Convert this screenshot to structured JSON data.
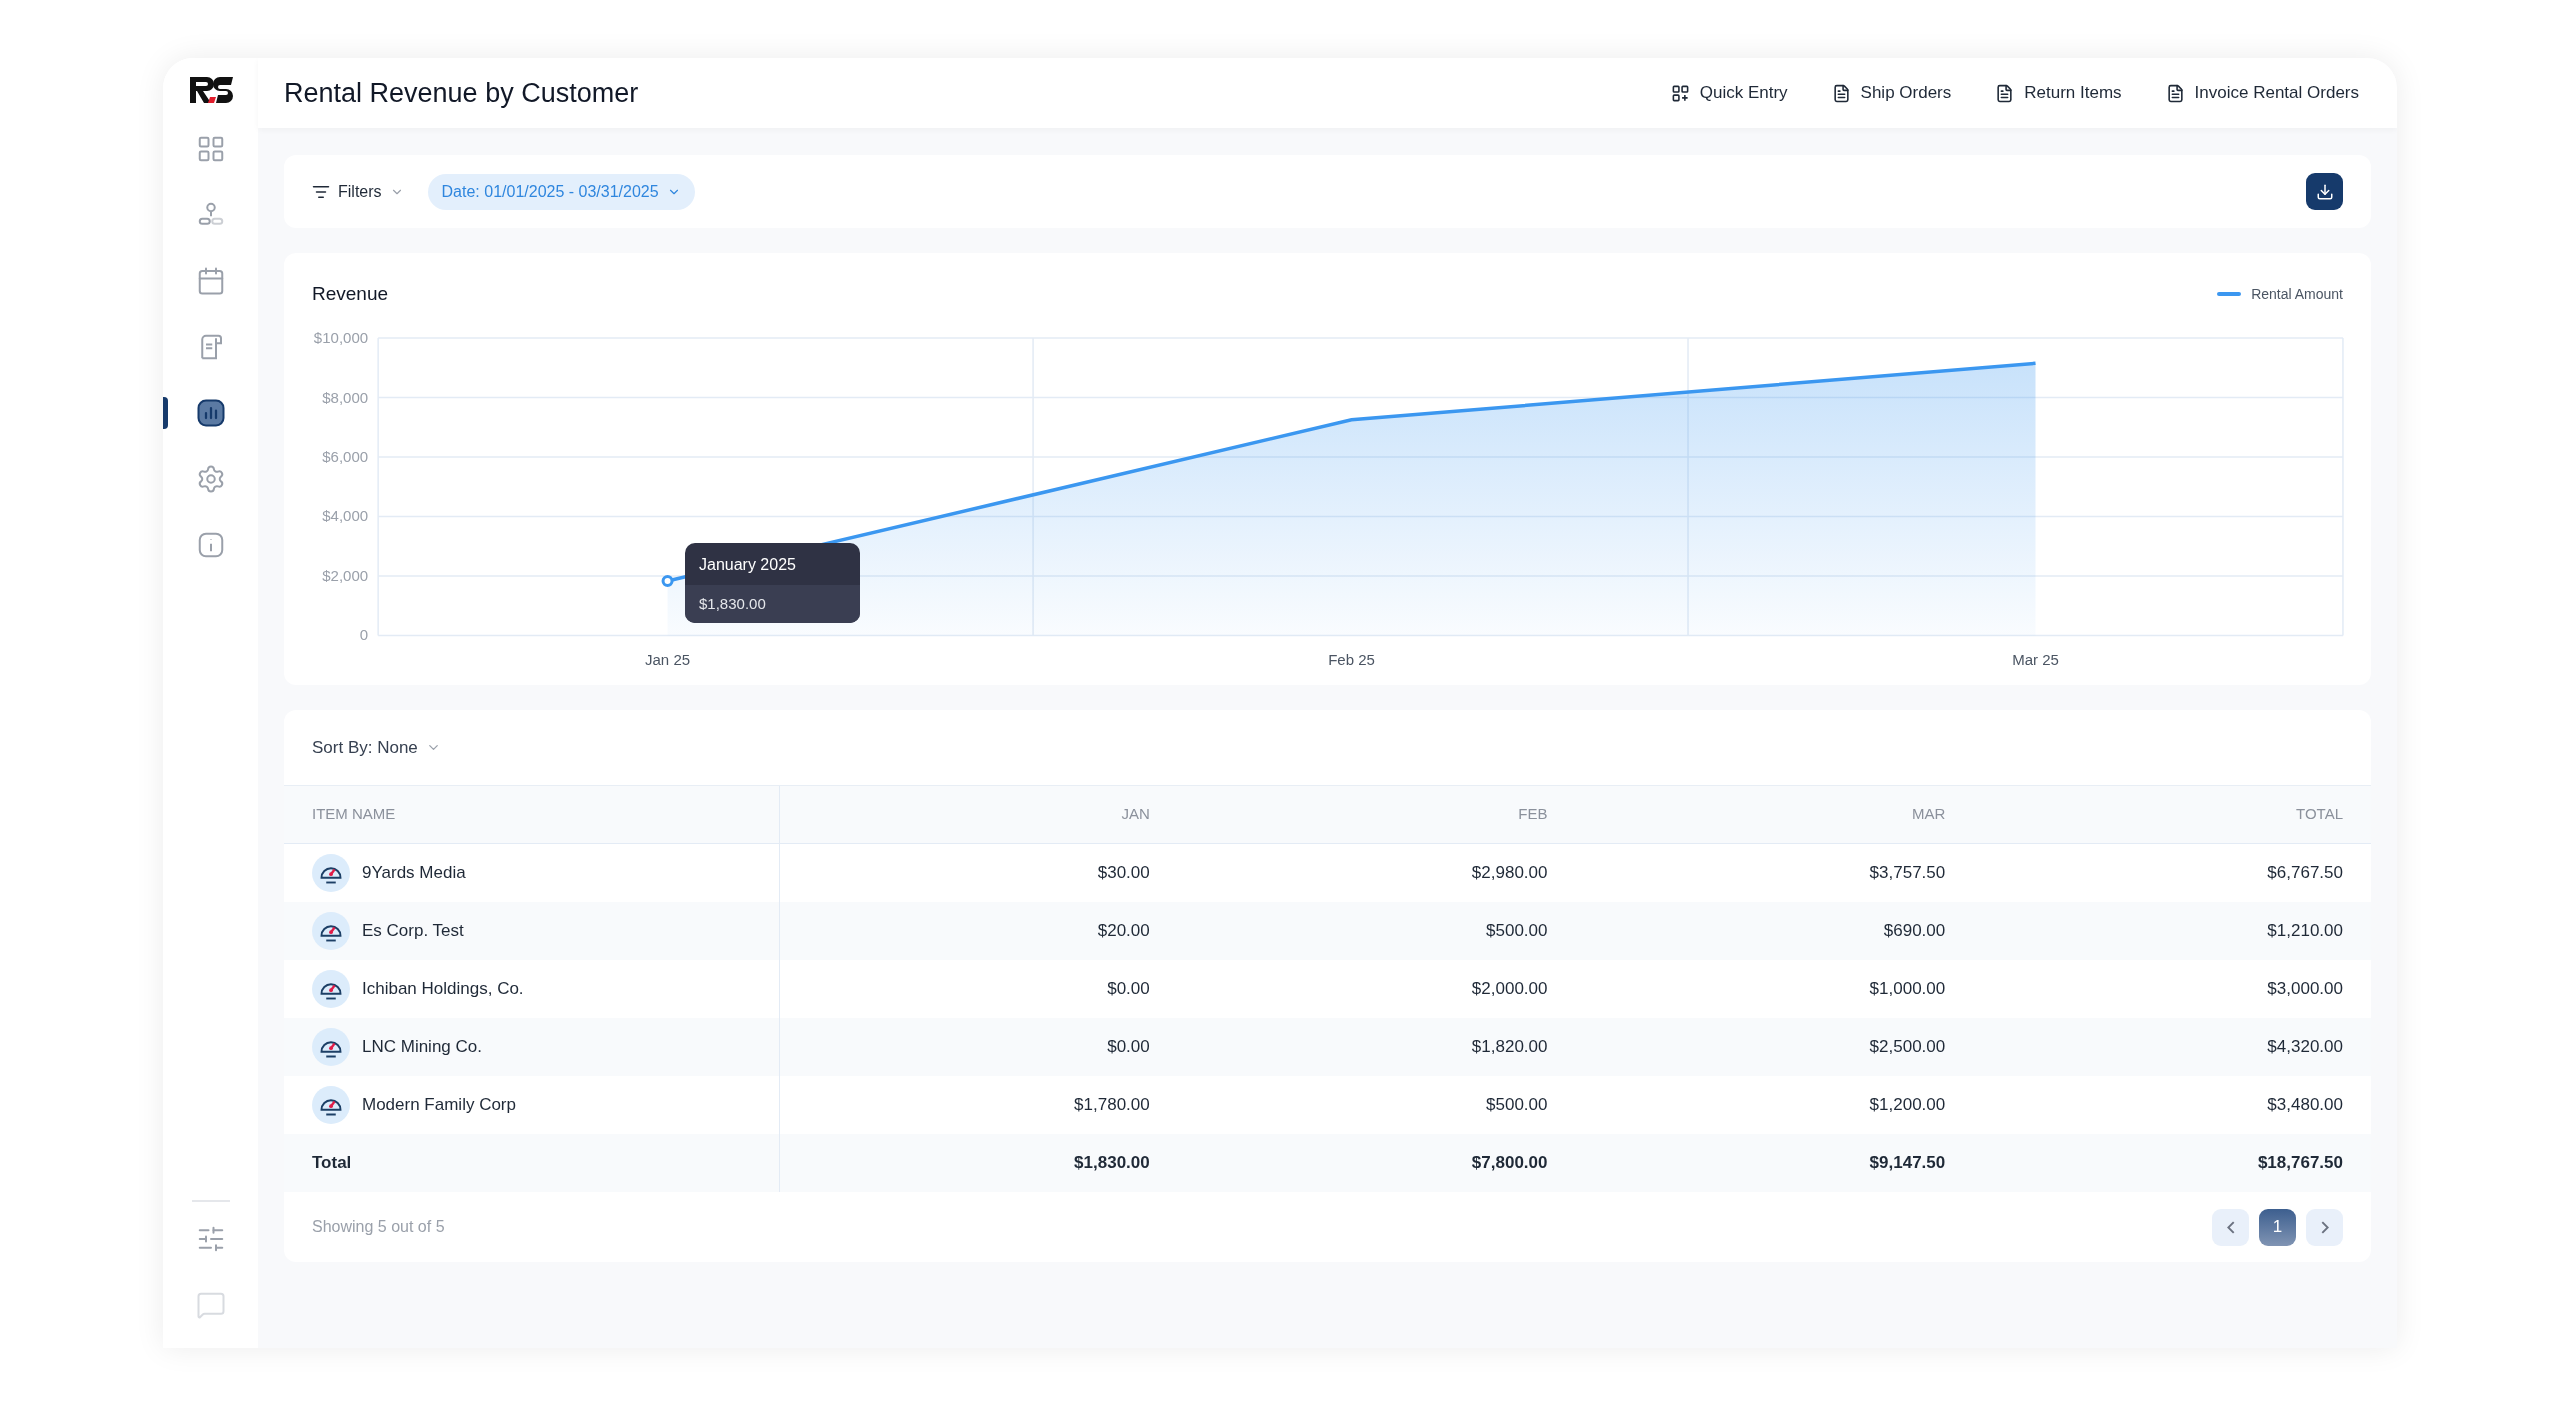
{
  "sidebar": {
    "items": [
      {
        "selected": false
      },
      {
        "selected": false
      },
      {
        "selected": false
      },
      {
        "selected": false
      },
      {
        "selected": true
      },
      {
        "selected": false
      },
      {
        "selected": false
      }
    ],
    "bottom_items": [
      {
        "selected": false
      },
      {
        "selected": false
      }
    ]
  },
  "header": {
    "title": "Rental Revenue by Customer",
    "actions": [
      {
        "label": "Quick Entry"
      },
      {
        "label": "Ship Orders"
      },
      {
        "label": "Return Items"
      },
      {
        "label": "Invoice Rental Orders"
      }
    ]
  },
  "filters": {
    "label": "Filters",
    "date_filter": "Date: 01/01/2025 - 03/31/2025"
  },
  "chart": {
    "title": "Revenue",
    "tooltip": {
      "title": "January 2025",
      "value": "$1,830.00"
    },
    "chart_data": {
      "type": "area",
      "categories": [
        "Jan 25",
        "Feb 25",
        "Mar 25"
      ],
      "series": [
        {
          "name": "Rental Amount",
          "color": "#3b97f0",
          "values": [
            1830,
            7250,
            9150
          ]
        }
      ],
      "ylim": [
        0,
        10000
      ],
      "grid": true,
      "yticks": [
        {
          "value": 0,
          "label": "0"
        },
        {
          "value": 2000,
          "label": "$2,000"
        },
        {
          "value": 4000,
          "label": "$4,000"
        },
        {
          "value": 6000,
          "label": "$6,000"
        },
        {
          "value": 8000,
          "label": "$8,000"
        },
        {
          "value": 10000,
          "label": "$10,000"
        }
      ]
    }
  },
  "table": {
    "sort_label": "Sort By: None",
    "columns": [
      "ITEM NAME",
      "JAN",
      "FEB",
      "MAR",
      "TOTAL"
    ],
    "rows": [
      {
        "cells": [
          "9Yards Media",
          "$30.00",
          "$2,980.00",
          "$3,757.50",
          "$6,767.50"
        ]
      },
      {
        "cells": [
          "Es Corp. Test",
          "$20.00",
          "$500.00",
          "$690.00",
          "$1,210.00"
        ]
      },
      {
        "cells": [
          "Ichiban Holdings, Co.",
          "$0.00",
          "$2,000.00",
          "$1,000.00",
          "$3,000.00"
        ]
      },
      {
        "cells": [
          "LNC Mining Co.",
          "$0.00",
          "$1,820.00",
          "$2,500.00",
          "$4,320.00"
        ]
      },
      {
        "cells": [
          "Modern Family Corp",
          "$1,780.00",
          "$500.00",
          "$1,200.00",
          "$3,480.00"
        ]
      }
    ],
    "total_row": [
      "Total",
      "$1,830.00",
      "$7,800.00",
      "$9,147.50",
      "$18,767.50"
    ],
    "footer": "Showing 5 out of 5",
    "pagination": {
      "pages": [
        {
          "label": "1",
          "selected": true
        }
      ]
    }
  }
}
